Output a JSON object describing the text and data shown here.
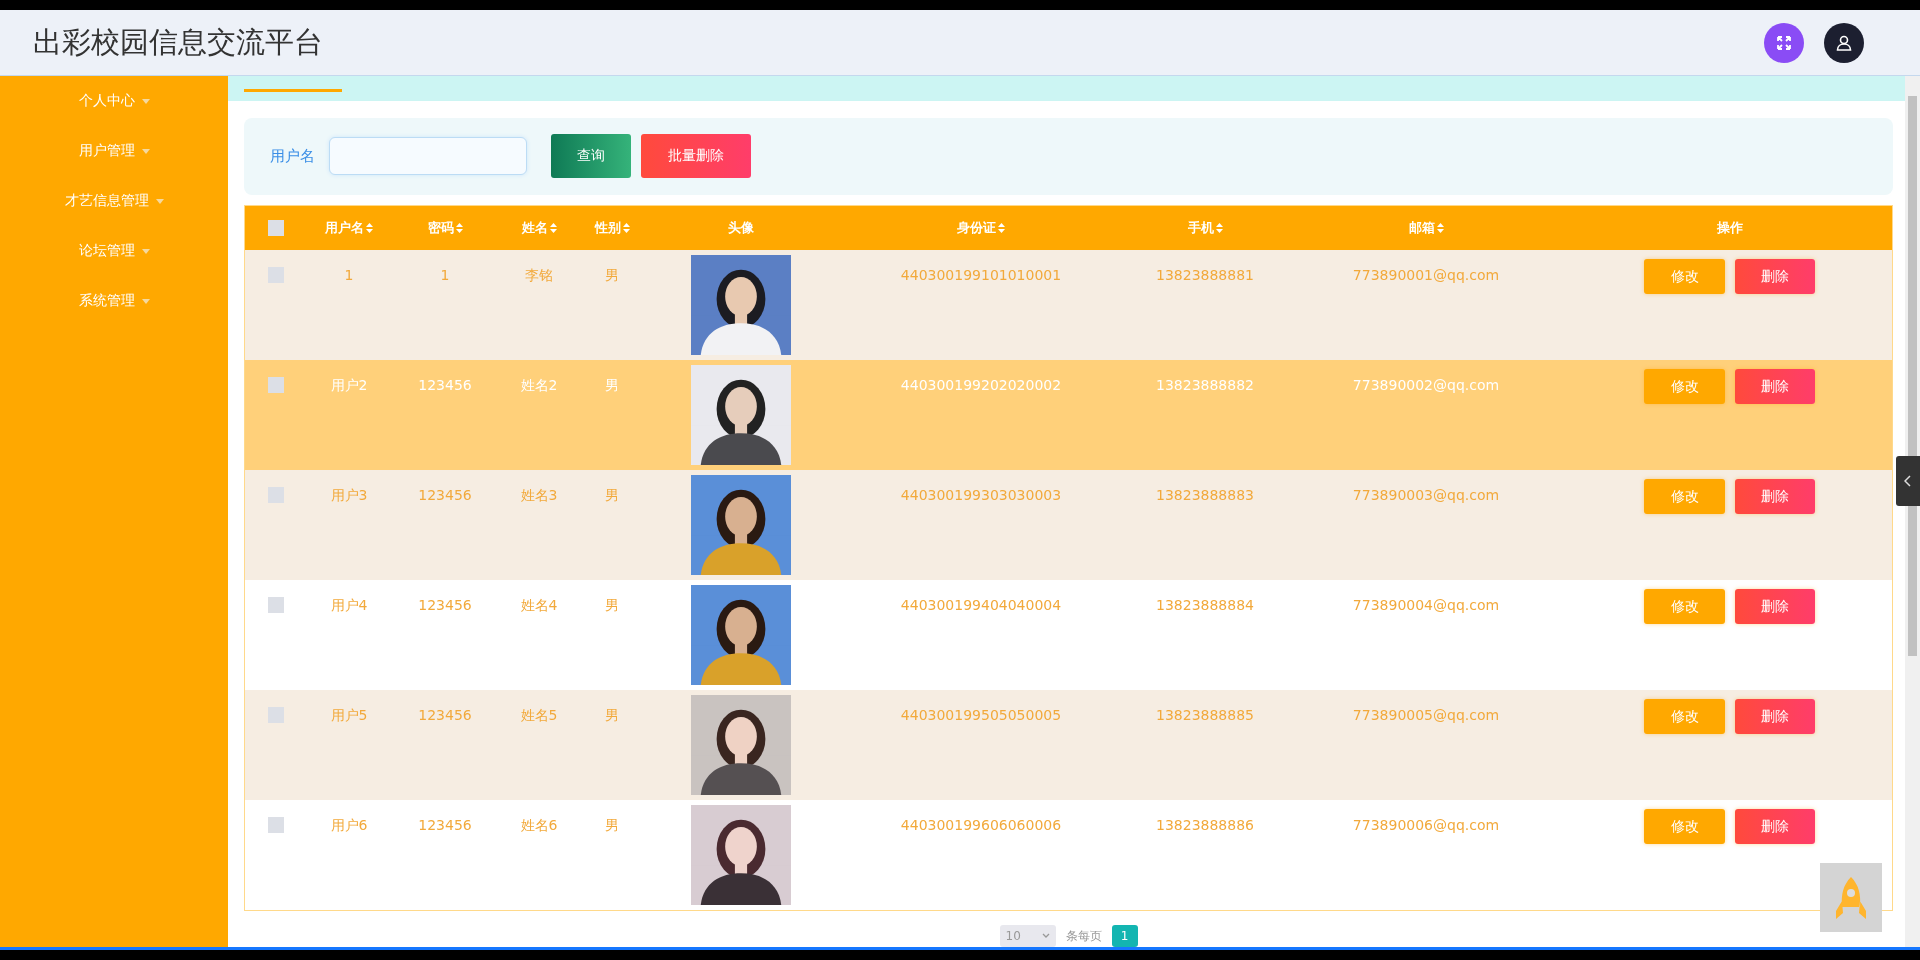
{
  "header": {
    "title": "出彩校园信息交流平台"
  },
  "sidebar": {
    "items": [
      {
        "label": "个人中心"
      },
      {
        "label": "用户管理"
      },
      {
        "label": "才艺信息管理"
      },
      {
        "label": "论坛管理"
      },
      {
        "label": "系统管理"
      }
    ]
  },
  "search": {
    "label": "用户名",
    "buttons": [
      {
        "label": "查询",
        "kind": "search"
      },
      {
        "label": "批量删除",
        "kind": "delete"
      }
    ]
  },
  "table": {
    "select_all": {
      "checked": false
    },
    "columns": [
      {
        "label": "用户名",
        "sortable": true
      },
      {
        "label": "密码",
        "sortable": true
      },
      {
        "label": "姓名",
        "sortable": true
      },
      {
        "label": "性别",
        "sortable": true
      },
      {
        "label": "头像",
        "sortable": false
      },
      {
        "label": "身份证",
        "sortable": true
      },
      {
        "label": "手机",
        "sortable": true
      },
      {
        "label": "邮箱",
        "sortable": true
      },
      {
        "label": "操作",
        "sortable": false
      }
    ],
    "rows": [
      {
        "checked": false,
        "highlighted": false,
        "username": "1",
        "password": "1",
        "name": "李铭",
        "gender": "男",
        "id_card": "440300199101010001",
        "phone": "13823888881",
        "email": "773890001@qq.com",
        "actions": [
          {
            "label": "修改",
            "kind": "edit"
          },
          {
            "label": "删除",
            "kind": "delete"
          }
        ]
      },
      {
        "checked": false,
        "highlighted": true,
        "username": "用户2",
        "password": "123456",
        "name": "姓名2",
        "gender": "男",
        "id_card": "440300199202020002",
        "phone": "13823888882",
        "email": "773890002@qq.com",
        "actions": [
          {
            "label": "修改",
            "kind": "edit"
          },
          {
            "label": "删除",
            "kind": "delete"
          }
        ]
      },
      {
        "checked": false,
        "highlighted": false,
        "username": "用户3",
        "password": "123456",
        "name": "姓名3",
        "gender": "男",
        "id_card": "440300199303030003",
        "phone": "13823888883",
        "email": "773890003@qq.com",
        "actions": [
          {
            "label": "修改",
            "kind": "edit"
          },
          {
            "label": "删除",
            "kind": "delete"
          }
        ]
      },
      {
        "checked": false,
        "highlighted": false,
        "username": "用户4",
        "password": "123456",
        "name": "姓名4",
        "gender": "男",
        "id_card": "440300199404040004",
        "phone": "13823888884",
        "email": "773890004@qq.com",
        "actions": [
          {
            "label": "修改",
            "kind": "edit"
          },
          {
            "label": "删除",
            "kind": "delete"
          }
        ]
      },
      {
        "checked": false,
        "highlighted": false,
        "username": "用户5",
        "password": "123456",
        "name": "姓名5",
        "gender": "男",
        "id_card": "440300199505050005",
        "phone": "13823888885",
        "email": "773890005@qq.com",
        "actions": [
          {
            "label": "修改",
            "kind": "edit"
          },
          {
            "label": "删除",
            "kind": "delete"
          }
        ]
      },
      {
        "checked": false,
        "highlighted": false,
        "username": "用户6",
        "password": "123456",
        "name": "姓名6",
        "gender": "男",
        "id_card": "440300199606060006",
        "phone": "13823888886",
        "email": "773890006@qq.com",
        "actions": [
          {
            "label": "修改",
            "kind": "edit"
          },
          {
            "label": "删除",
            "kind": "delete"
          }
        ]
      }
    ]
  },
  "pagination": {
    "page_size": "10",
    "unit": "条每页",
    "pages": [
      {
        "label": "1",
        "selected": true
      }
    ]
  }
}
